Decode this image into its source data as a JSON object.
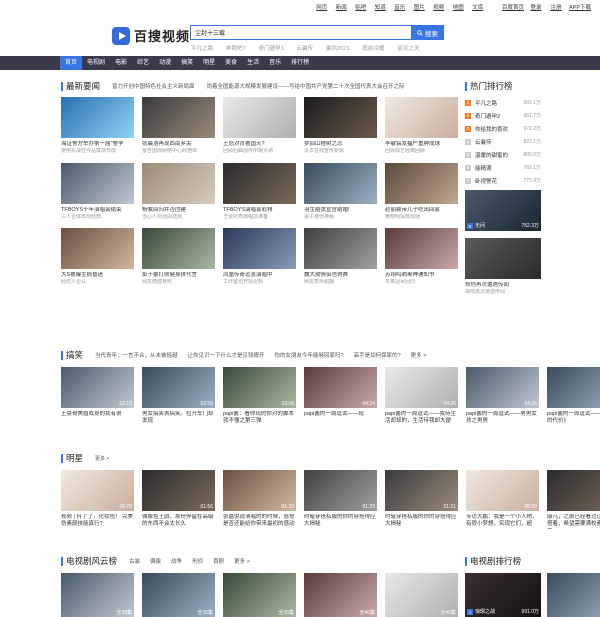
{
  "topbar": {
    "links": [
      "网页",
      "新闻",
      "贴吧",
      "知道",
      "音乐",
      "图片",
      "视频",
      "地图",
      "文库"
    ],
    "right": [
      "百度首页",
      "登录",
      "注册",
      "APP下载"
    ]
  },
  "logo": {
    "text": "百搜视频"
  },
  "search": {
    "value": "尘封十三载",
    "button": "搜索"
  },
  "hotwords": [
    "平凡之路",
    "奔跑吧7",
    "奇门遁甲3",
    "云襄传",
    "乘风2023",
    "庭前冷暖",
    "驭灵之天"
  ],
  "nav": [
    "首页",
    "电视剧",
    "电影",
    "综艺",
    "动漫",
    "搞笑",
    "明星",
    "美食",
    "生活",
    "音乐",
    "排行榜"
  ],
  "news": {
    "title": "最新要闻",
    "headlines": [
      "曾力开创中国特色社会主义新局面",
      "尚着全国能源大规模发展建设——写给中国共产党第二十次全国代表大会召开之际"
    ],
    "cards": [
      {
        "cap": "海证警方举办第一届\"警学",
        "sub": "使用实战性作品模块日成"
      },
      {
        "cap": "张晨浩再现西南乡关",
        "sub": "报告国际网络中心跃宿体"
      },
      {
        "cap": "王怒对背著国天?",
        "sub": "回顾后曲创作中期大纳"
      },
      {
        "cap": "梦回山楂树之恋",
        "sub": "清华在线宣传新频"
      },
      {
        "cap": "李敏镐发福严重肿成球",
        "sub": "回顾综艺经典回顾"
      },
      {
        "cap": "TFBOYS十年演唱会结束",
        "sub": "三人合体再现经典"
      },
      {
        "cap": "杨紫回归并否团建",
        "sub": "当心人对自由选择"
      },
      {
        "cap": "TFBOYS演唱会彩排",
        "sub": "王源对秀演唱前准备"
      },
      {
        "cap": "羽生结弦宣官结婚!",
        "sub": "妻子身份神秘"
      },
      {
        "cap": "赵丽颖带儿子吃出回家",
        "sub": "黄晓明探班现场"
      },
      {
        "cap": "大S被曝生病昏迷",
        "sub": "经纪人否认"
      },
      {
        "cap": "彭于晏打败健身拼代言",
        "sub": "网友晒健身照"
      },
      {
        "cap": "凤凰传奇远涨演唱中",
        "sub": "工作室也开始迟到"
      },
      {
        "cap": "魏大勋情侣也得赛",
        "sub": "网友表示甜翻"
      },
      {
        "cap": "苏翊鸣晒奥神通知书",
        "sub": "冬奥冠军回归"
      }
    ]
  },
  "rank": {
    "title": "热门排行榜",
    "items": [
      {
        "n": "1",
        "name": "平凡之路",
        "val": "992.1万"
      },
      {
        "n": "2",
        "name": "奇门遁甲2",
        "val": "981.7万"
      },
      {
        "n": "3",
        "name": "你给我的喜欢",
        "val": "972.2万"
      },
      {
        "n": "4",
        "name": "云襄传",
        "val": "822.1万"
      },
      {
        "n": "5",
        "name": "温暖的甜蜜的",
        "val": "805.0万"
      },
      {
        "n": "6",
        "name": "能精满",
        "val": "782.1万"
      },
      {
        "n": "7",
        "name": "卧视警花",
        "val": "777.4万"
      }
    ],
    "big": {
      "n": "8",
      "name": "无间",
      "val": "752.3万"
    },
    "extra": {
      "cap": "郑恺再次遭遇传闻",
      "sub": "郑恺再次遭遇传闻"
    }
  },
  "funny": {
    "title": "搞笑",
    "tags": [
      "当代青年：一言不合，从未被摇越",
      "让你见识一下什么才是见钱眼开",
      "你的女朋友今年能够回家吗?",
      "高手是如何保家的?",
      "更多 >"
    ],
    "cards": [
      {
        "cap": "土豪哥美眉成身的我有很",
        "dur": "02:15"
      },
      {
        "cap": "男女搞笑表搞笑。拉开车门却发现",
        "dur": "02:55"
      },
      {
        "cap": "papi酱：看你现的你对的脚本就不懂之第三弹",
        "dur": "03:08"
      },
      {
        "cap": "papi酱的一周逗试——现",
        "dur": "04:24"
      },
      {
        "cap": "papi酱的一周逗试——我待生活却却的，生活待我却大便",
        "dur": "04:26"
      },
      {
        "cap": "papi酱的一周逗试——男男女孩之男男",
        "dur": "04:26"
      },
      {
        "cap": "papi酱的一周逗试——《外挂的代价》",
        "dur": "04:31"
      }
    ]
  },
  "star": {
    "title": "明星",
    "more": "更多 >",
    "cards": [
      {
        "cap": "视频 | 抖了了，化妆包！ 完美伪素颜技能真行?",
        "dur": "06:23"
      },
      {
        "cap": "偶像恰王韵，那份停留在高级的东西不会太长久",
        "dur": "01:56"
      },
      {
        "cap": "张嘉倪说清唱的的时候，感觉是否还能给你带来最初的感动",
        "dur": "01:33"
      },
      {
        "cap": "时髦穿搭私服的你的穿搭得应大揭秘",
        "dur": "01:29"
      },
      {
        "cap": "时髦穿搭私服的你的穿搭得应大揭秘",
        "dur": "01:21"
      },
      {
        "cap": "专访大鹏：我是一个小人物，有很小梦想，实现它们，超",
        "dur": "05:02"
      },
      {
        "cap": "康凡，之前已经看过让谁的穿搭着，希望需要满校素说你话着",
        "dur": "05:22"
      }
    ]
  },
  "drama": {
    "title": "电视剧风云榜",
    "tags": [
      "古装",
      "偶像",
      "战争",
      "刑侦",
      "喜剧",
      "更多 >"
    ],
    "cards": [
      {
        "dur": "全39集"
      },
      {
        "dur": "全35集"
      },
      {
        "dur": "全36集"
      },
      {
        "dur": "全40集"
      },
      {
        "dur": "全46集"
      },
      {
        "dur": "全39集"
      },
      {
        "dur": "全44集"
      }
    ],
    "rank_title": "电视剧排行榜",
    "rank_big": {
      "n": "1",
      "name": "琅琊之战",
      "val": "991.0万"
    }
  }
}
